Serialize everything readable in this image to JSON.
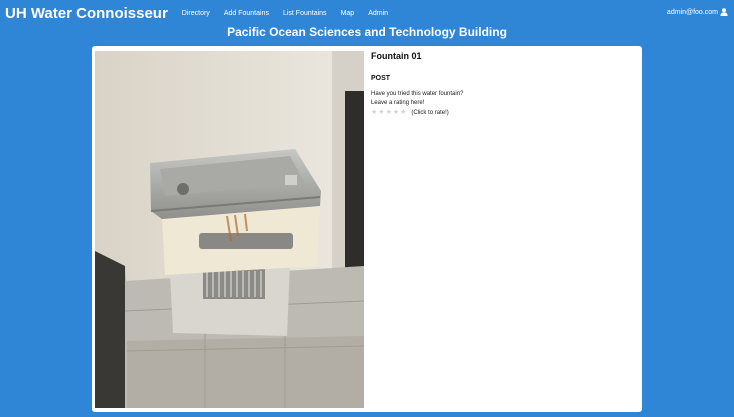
{
  "navbar": {
    "brand": "UH Water Connoisseur",
    "links": [
      "Directory",
      "Add Fountains",
      "List Fountains",
      "Map",
      "Admin"
    ],
    "user": "admin@foo.com"
  },
  "building": {
    "title": "Pacific Ocean Sciences and Technology Building"
  },
  "fountain": {
    "name": "Fountain 01",
    "post_label": "POST",
    "prompt_line1": "Have you tried this water fountain?",
    "prompt_line2": "Leave a rating here!",
    "rating_hint": "(Click to rate!)",
    "stars_total": 5
  },
  "icons": {
    "user": "user-icon",
    "star": "star-icon"
  },
  "colors": {
    "background": "#2f86d6",
    "card": "#ffffff",
    "star_empty": "#d4d4d4"
  }
}
